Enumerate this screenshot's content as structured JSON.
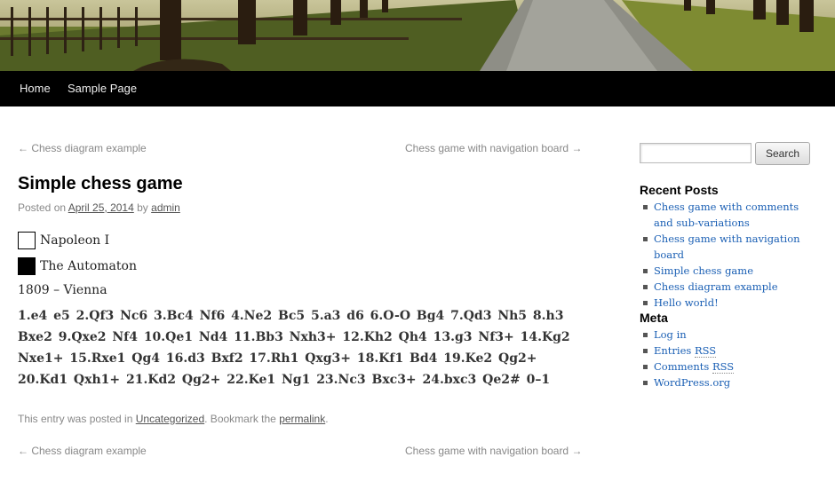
{
  "header": {
    "nav": [
      "Home",
      "Sample Page"
    ]
  },
  "post_nav": {
    "prev": "← Chess diagram example",
    "next": "Chess game with navigation board →"
  },
  "post": {
    "title": "Simple chess game",
    "meta_posted_on": "Posted on",
    "meta_date": "April 25, 2014",
    "meta_by": "by",
    "meta_author": "admin",
    "white_player": "Napoleon I",
    "black_player": "The Automaton",
    "event": "1809 – Vienna",
    "moves_lines": [
      "1.e4 e5 2.Qf3 Nc6 3.Bc4 Nf6 4.Ne2 Bc5 5.a3 d6 6.O-O Bg4 7.Qd3 Nh5 8.h3",
      "Bxe2 9.Qxe2 Nf4 10.Qe1 Nd4 11.Bb3 Nxh3+ 12.Kh2 Qh4 13.g3 Nf3+ 14.Kg2",
      "Nxe1+ 15.Rxe1 Qg4 16.d3 Bxf2 17.Rh1 Qxg3+ 18.Kf1 Bd4 19.Ke2 Qg2+",
      "20.Kd1 Qxh1+ 21.Kd2 Qg2+ 22.Ke1 Ng1 23.Nc3 Bxc3+ 24.bxc3 Qe2# 0–1"
    ],
    "footer_text_1": "This entry was posted in",
    "footer_category": "Uncategorized",
    "footer_text_2": ". Bookmark the",
    "footer_permalink": "permalink",
    "footer_text_3": "."
  },
  "sidebar": {
    "search_button": "Search",
    "recent_posts_title": "Recent Posts",
    "recent_posts": [
      "Chess game with comments and sub-variations",
      "Chess game with navigation board",
      "Simple chess game",
      "Chess diagram example",
      "Hello world!"
    ],
    "meta_title": "Meta",
    "meta_links": {
      "login": "Log in",
      "entries_prefix": "Entries",
      "entries_rss": "RSS",
      "comments_prefix": "Comments",
      "comments_rss": "RSS",
      "wordpress": "WordPress.org"
    }
  },
  "colors": {
    "nav_bg": "#000000",
    "link_blue": "#1a5fb4"
  }
}
